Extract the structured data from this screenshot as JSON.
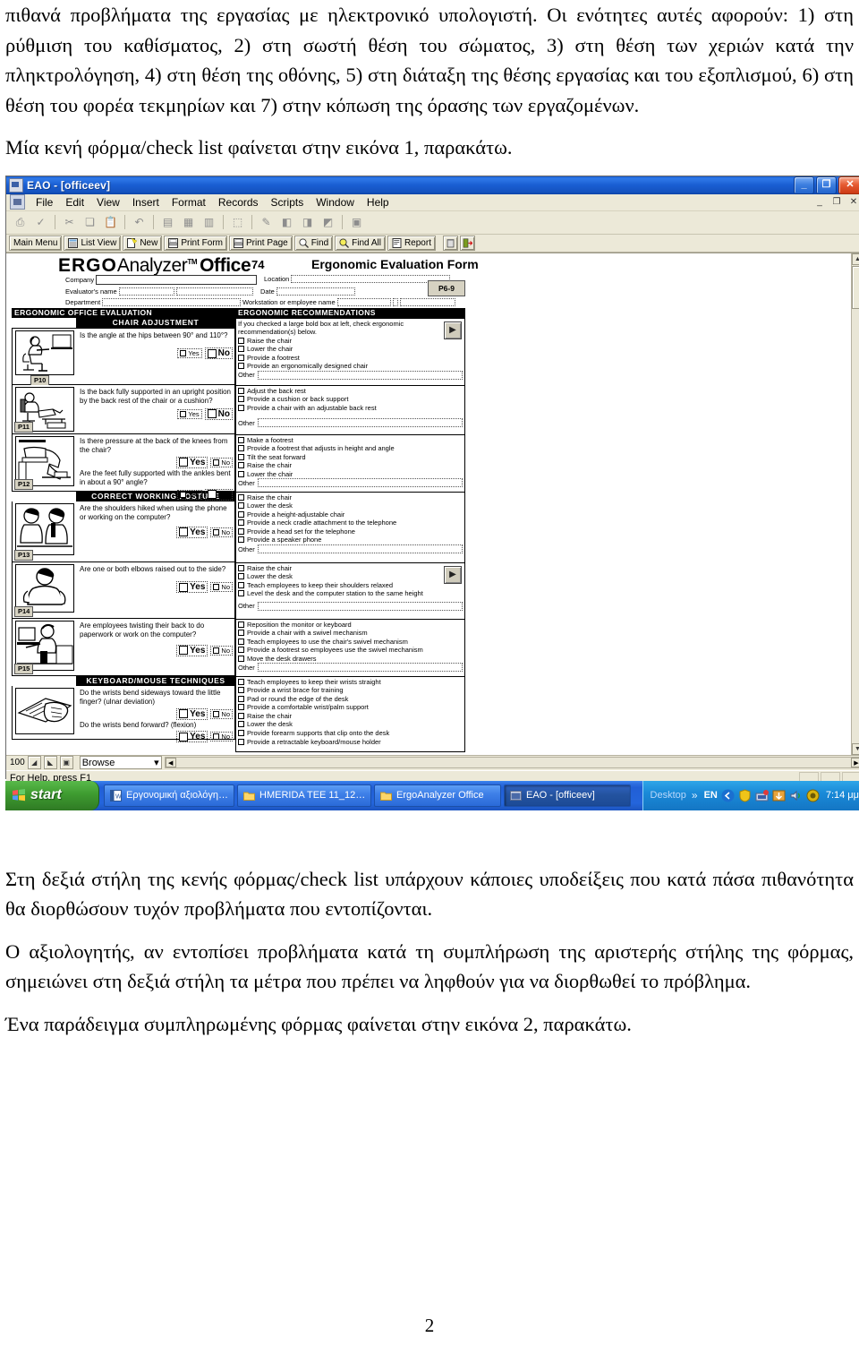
{
  "document": {
    "paragraphs": [
      "πιθανά προβλήματα της εργασίας με ηλεκτρονικό υπολογιστή. Οι ενότητες αυτές αφορούν: 1) στη ρύθμιση του καθίσματος, 2) στη σωστή θέση του σώματος, 3) στη θέση των χεριών κατά την πληκτρολόγηση, 4) στη θέση της οθόνης, 5) στη διάταξη της θέσης εργασίας και του εξοπλισμού, 6) στη θέση του φορέα τεκμηρίων και 7) στην κόπωση της όρασης των εργαζομένων.",
      "Μία κενή φόρμα/check list φαίνεται στην εικόνα 1, παρακάτω."
    ],
    "paragraphs_after": [
      "Στη δεξιά στήλη της κενής φόρμας/check list υπάρχουν κάποιες υποδείξεις που κατά πάσα πιθανότητα θα διορθώσουν τυχόν προβλήματα που εντοπίζονται.",
      "Ο αξιολογητής, αν εντοπίσει προβλήματα κατά τη συμπλήρωση της αριστερής στήλης της φόρμας, σημειώνει στη δεξιά στήλη τα μέτρα που πρέπει να ληφθούν για να διορθωθεί το πρόβλημα.",
      "Ένα παράδειγμα συμπληρωμένης φόρμας φαίνεται στην εικόνα 2, παρακάτω."
    ],
    "page_number": "2"
  },
  "screenshot": {
    "window": {
      "title": "EAO - [officeev]",
      "app_icon": "app-window-icon",
      "controls": [
        {
          "name": "minimize",
          "glyph": "_"
        },
        {
          "name": "maximize",
          "glyph": "❐"
        },
        {
          "name": "close",
          "glyph": "✕"
        }
      ],
      "mdi_controls": [
        {
          "name": "mdi-minimize",
          "glyph": "_"
        },
        {
          "name": "mdi-restore",
          "glyph": "❐"
        },
        {
          "name": "mdi-close",
          "glyph": "✕"
        }
      ]
    },
    "menubar": {
      "doc_icon": "document-icon",
      "items": [
        "File",
        "Edit",
        "View",
        "Insert",
        "Format",
        "Records",
        "Scripts",
        "Window",
        "Help"
      ]
    },
    "icon_toolbar": [
      {
        "name": "print-icon",
        "glyph": "⎙"
      },
      {
        "name": "spell-check-icon",
        "glyph": "✓"
      },
      {
        "name": "cut-icon",
        "glyph": "✂"
      },
      {
        "name": "copy-icon",
        "glyph": "❏"
      },
      {
        "name": "paste-icon",
        "glyph": "📋"
      },
      {
        "name": "undo-icon",
        "glyph": "↶"
      },
      {
        "name": "group-icon",
        "glyph": "▤"
      },
      {
        "name": "ungroup-icon",
        "glyph": "▦"
      },
      {
        "name": "align-icon",
        "glyph": "▥"
      },
      {
        "name": "object-icon",
        "glyph": "⬚"
      },
      {
        "name": "format-painter-icon",
        "glyph": "✎"
      },
      {
        "name": "fill-color-icon",
        "glyph": "◧"
      },
      {
        "name": "pen-color-icon",
        "glyph": "◨"
      },
      {
        "name": "effects-icon",
        "glyph": "◩"
      },
      {
        "name": "script-icon",
        "glyph": "▣"
      }
    ],
    "button_toolbar": [
      {
        "label": "Main Menu",
        "icon": "none"
      },
      {
        "label": "List View",
        "icon": "list-view-icon"
      },
      {
        "label": "New",
        "icon": "new-record-icon"
      },
      {
        "label": "Print Form",
        "icon": "printer-icon"
      },
      {
        "label": "Print Page",
        "icon": "printer-icon"
      },
      {
        "label": "Find",
        "icon": "magnifier-icon"
      },
      {
        "label": "Find All",
        "icon": "magnifier-all-icon"
      },
      {
        "label": "Report",
        "icon": "report-icon"
      }
    ],
    "right_tools": [
      {
        "name": "delete-record-icon",
        "glyph": "🗑"
      },
      {
        "name": "exit-icon",
        "glyph": "⇥"
      }
    ],
    "form": {
      "brand_ergo": "ERGO",
      "brand_analyzer": "Analyzer",
      "brand_tm": "TM",
      "brand_office": "Office",
      "record_number": "74",
      "form_title": "Ergonomic Evaluation Form",
      "page_tab": "P6-9",
      "fields": [
        {
          "label": "Company",
          "value": ""
        },
        {
          "label": "Location",
          "value": ""
        },
        {
          "label": "Evaluator's name",
          "value": ""
        },
        {
          "label": "Date",
          "value": ""
        },
        {
          "label": "Department",
          "value": ""
        },
        {
          "label": "Workstation or employee name",
          "value": ""
        }
      ],
      "column_headers": {
        "left": "ERGONOMIC OFFICE EVALUATION",
        "right": "ERGONOMIC RECOMMENDATIONS"
      },
      "recommendation_note": "If you checked a large bold box at left, check ergonomic recommendation(s) below.",
      "other_label": "Other",
      "section_bars": [
        "CHAIR ADJUSTMENT",
        "CORRECT WORKING POSTURE",
        "KEYBOARD/MOUSE TECHNIQUES"
      ],
      "rows": [
        {
          "plabel": "P10",
          "picture": "seated-person-at-desk-icon",
          "section": "CHAIR ADJUSTMENT",
          "questions": [
            {
              "text": "Is the angle at the hips between 90° and 110°?",
              "yes_big": false,
              "no_big": true
            }
          ],
          "recommendations": [
            "Raise the chair",
            "Lower the chair",
            "Provide a footrest",
            "Provide an ergonomically designed chair"
          ],
          "has_next_button": true
        },
        {
          "plabel": "P11",
          "picture": "back-support-chair-icon",
          "section": "",
          "questions": [
            {
              "text": "Is the back fully supported in an upright position by the back rest of the chair or a cushion?",
              "yes_big": false,
              "no_big": true
            }
          ],
          "recommendations": [
            "Adjust the back rest",
            "Provide a cushion or back support",
            "Provide a chair with an adjustable back rest"
          ],
          "has_next_button": false
        },
        {
          "plabel": "P12",
          "picture": "legs-knees-footrest-icon",
          "section": "",
          "questions": [
            {
              "text": "Is there pressure at the back of the knees from the chair?",
              "yes_big": true,
              "no_big": false
            },
            {
              "text": "Are the feet fully supported with the ankles bent in about a 90° angle?",
              "yes_big": false,
              "no_big": true
            }
          ],
          "recommendations": [
            "Make a footrest",
            "Provide a footrest that adjusts in height and angle",
            "Tilt the seat forward",
            "Raise the chair",
            "Lower the chair"
          ],
          "has_next_button": false
        },
        {
          "plabel": "P13",
          "picture": "phone-shoulder-posture-icon",
          "section": "CORRECT WORKING POSTURE",
          "questions": [
            {
              "text": "Are the shoulders hiked when using the phone or working on the computer?",
              "yes_big": true,
              "no_big": false
            }
          ],
          "recommendations": [
            "Raise the chair",
            "Lower the desk",
            "Provide a height-adjustable chair",
            "Provide a neck cradle attachment to the telephone",
            "Provide a head set for the telephone",
            "Provide a speaker phone"
          ],
          "has_next_button": false
        },
        {
          "plabel": "P14",
          "picture": "elbows-out-torso-icon",
          "section": "",
          "questions": [
            {
              "text": "Are one or both elbows raised out to the side?",
              "yes_big": true,
              "no_big": false
            }
          ],
          "recommendations": [
            "Raise the chair",
            "Lower the desk",
            "Teach employees to keep their shoulders relaxed",
            "Level the desk and the computer station to the same height"
          ],
          "has_next_button": true
        },
        {
          "plabel": "P15",
          "picture": "twisting-back-at-desk-icon",
          "section": "",
          "questions": [
            {
              "text": "Are employees twisting their back to do paperwork or work on the computer?",
              "yes_big": true,
              "no_big": false
            }
          ],
          "recommendations": [
            "Reposition the monitor or keyboard",
            "Provide a chair with a swivel mechanism",
            "Teach employees to use the chair's swivel mechanism",
            "Provide a footrest so employees use the swivel mechanism",
            "Move the desk drawers"
          ],
          "has_next_button": false
        },
        {
          "plabel": "",
          "picture": "hand-on-keyboard-icon",
          "section": "KEYBOARD/MOUSE TECHNIQUES",
          "questions": [
            {
              "text": "Do the wrists bend sideways toward the little finger? (ulnar deviation)",
              "yes_big": true,
              "no_big": false
            },
            {
              "text": "Do the wrists bend forward? (flexion)",
              "yes_big": true,
              "no_big": false
            }
          ],
          "recommendations": [
            "Teach employees to keep their wrists straight",
            "Provide a wrist brace for training",
            "Pad or round the edge of the desk",
            "Provide a comfortable wrist/palm support",
            "Raise the chair",
            "Lower the desk",
            "Provide forearm supports that clip onto the desk",
            "Provide a retractable keyboard/mouse holder"
          ],
          "has_next_button": false
        }
      ]
    },
    "zoom_bar": {
      "zoom_level": "100",
      "zoom_out_icon": "zoom-out-icon",
      "zoom_in_icon": "zoom-in-icon",
      "toggle_icon": "toggle-status-area-icon",
      "mode": "Browse",
      "mode_arrow": "▾"
    },
    "status_bar": {
      "text": "For Help, press F1"
    },
    "taskbar": {
      "start_label": "start",
      "tasks": [
        {
          "label": "Εργονομική αξιολόγη…",
          "icon": "word-doc-icon",
          "active": false
        },
        {
          "label": "HMERIDA TEE 11_12…",
          "icon": "folder-icon",
          "active": false
        },
        {
          "label": "ErgoAnalyzer Office",
          "icon": "folder-icon",
          "active": false
        },
        {
          "label": "EAO - [officeev]",
          "icon": "app-window-icon",
          "active": true
        }
      ],
      "desktop_label": "Desktop",
      "chevron": "»",
      "language": "EN",
      "tray_icons": [
        "back-arrow-icon",
        "shield-icon",
        "network-icon",
        "update-icon",
        "volume-icon",
        "antivirus-icon"
      ],
      "clock": "7:14 μμ"
    }
  }
}
